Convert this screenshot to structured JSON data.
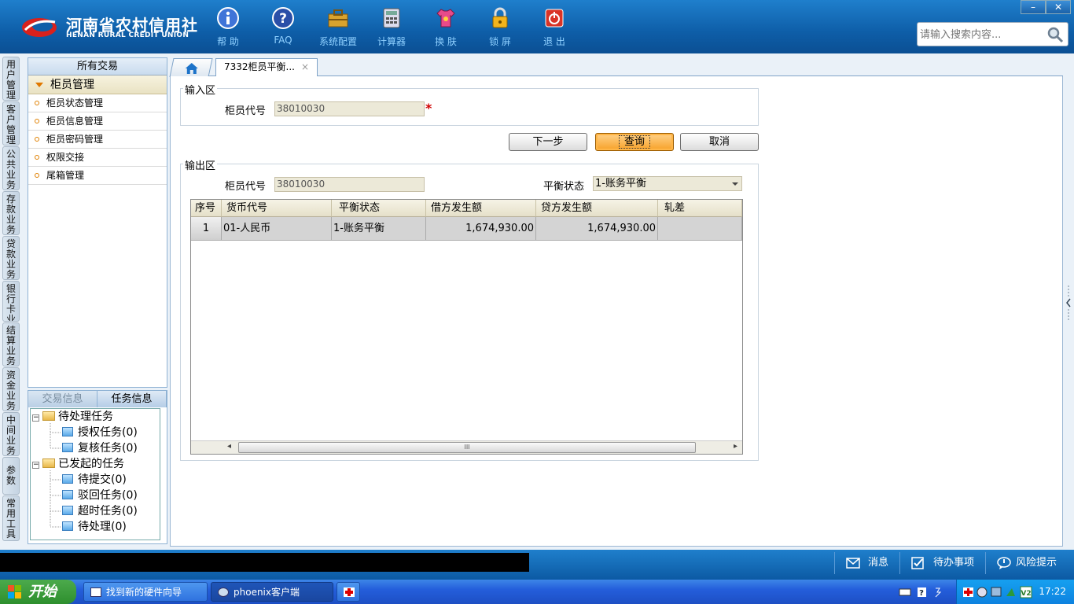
{
  "app": {
    "logo_cn": "河南省农村信用社",
    "logo_en": "HENAN RURAL CREDIT UNION"
  },
  "toolbar": [
    {
      "label": "帮 助",
      "icon": "info-icon"
    },
    {
      "label": "FAQ",
      "icon": "question-icon"
    },
    {
      "label": "系统配置",
      "icon": "toolbox-icon"
    },
    {
      "label": "计算器",
      "icon": "calculator-icon"
    },
    {
      "label": "换 肤",
      "icon": "shirt-icon"
    },
    {
      "label": "锁 屏",
      "icon": "lock-icon"
    },
    {
      "label": "退 出",
      "icon": "power-icon"
    }
  ],
  "window_buttons": {
    "minimize": "–",
    "close": "✕"
  },
  "search": {
    "placeholder": "请输入搜索内容..."
  },
  "vertical_tabs": [
    "用户管理",
    "客户管理",
    "公共业务",
    "存款业务",
    "贷款业务",
    "银行卡业务",
    "结算业务",
    "资金业务",
    "中间业务",
    "参数",
    "常用工具"
  ],
  "left_panel": {
    "header": "所有交易",
    "group": "柜员管理",
    "items": [
      "柜员状态管理",
      "柜员信息管理",
      "柜员密码管理",
      "权限交接",
      "尾箱管理"
    ]
  },
  "task_panel": {
    "tabs": [
      "交易信息",
      "任务信息"
    ],
    "tree": {
      "pending": {
        "label": "待处理任务",
        "children": [
          "授权任务(0)",
          "复核任务(0)"
        ]
      },
      "initiated": {
        "label": "已发起的任务",
        "children": [
          "待提交(0)",
          "驳回任务(0)",
          "超时任务(0)",
          "待处理(0)"
        ]
      }
    }
  },
  "tabs": {
    "active": "7332柜员平衡...",
    "close": "×"
  },
  "form": {
    "input_legend": "输入区",
    "teller_label": "柜员代号",
    "teller_value": "38010030",
    "required_mark": "*",
    "buttons": {
      "next": "下一步",
      "query": "查询",
      "cancel": "取消"
    },
    "output_legend": "输出区",
    "out_teller_label": "柜员代号",
    "out_teller_value": "38010030",
    "balance_label": "平衡状态",
    "balance_value": "1-账务平衡"
  },
  "grid": {
    "columns": [
      "序号",
      "货币代号",
      "平衡状态",
      "借方发生额",
      "贷方发生额",
      "轧差"
    ],
    "rows": [
      {
        "seq": "1",
        "currency": "01-人民币",
        "status": "1-账务平衡",
        "debit": "1,674,930.00",
        "credit": "1,674,930.00",
        "diff": ""
      }
    ],
    "scroll_left": "◂",
    "scroll_right": "▸",
    "scroll_grip": "III"
  },
  "status_bar": {
    "message": "消息",
    "todo": "待办事项",
    "risk": "风险提示"
  },
  "taskbar": {
    "start": "开始",
    "items": [
      "找到新的硬件向导",
      "phoenix客户端"
    ],
    "clock": "17:22"
  },
  "colors": {
    "header_blue": "#0e5ea8",
    "accent_orange": "#f7a128",
    "required_red": "#d00000"
  }
}
